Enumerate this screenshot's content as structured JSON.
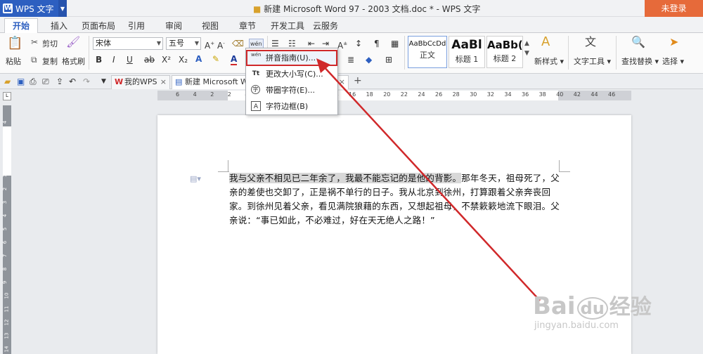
{
  "titlebar": {
    "app_button": "WPS 文字",
    "doc_title": "新建 Microsoft Word 97 - 2003 文档.doc * - WPS 文字",
    "login": "未登录"
  },
  "menu_tabs": [
    "开始",
    "插入",
    "页面布局",
    "引用",
    "审阅",
    "视图",
    "章节",
    "开发工具",
    "云服务"
  ],
  "ribbon": {
    "paste": "粘贴",
    "cut": "剪切",
    "copy": "复制",
    "format_painter": "格式刷",
    "font_name": "宋体",
    "font_size": "五号",
    "bold": "B",
    "italic": "I",
    "underline": "U",
    "styles": [
      {
        "preview": "AaBbCcDd",
        "name": "正文"
      },
      {
        "preview": "AaBl",
        "name": "标题 1"
      },
      {
        "preview": "AaBb(",
        "name": "标题 2"
      }
    ],
    "new_style": "新样式",
    "text_tools": "文字工具",
    "find_replace": "查找替换",
    "select": "选择"
  },
  "doc_tabs": [
    {
      "label": "我的WPS"
    },
    {
      "label": "新建 Microsoft W"
    }
  ],
  "dropdown": {
    "items": [
      {
        "icon": "wén",
        "label": "拼音指南(U)..."
      },
      {
        "icon": "Tt",
        "label": "更改大小写(C)..."
      },
      {
        "icon": "字",
        "label": "带圈字符(E)..."
      },
      {
        "icon": "A",
        "label": "字符边框(B)"
      }
    ]
  },
  "document": {
    "highlighted": "我与父亲不相见已二年余了，我最不能忘记的是他的背影。",
    "rest": "那年冬天，祖母死了，父亲的差使也交卸了，正是祸不单行的日子。我从北京到徐州，打算跟着父亲奔丧回家。到徐州见着父亲，看见满院狼藉的东西，又想起祖母，不禁簌簌地流下眼泪。父亲说：“事已如此，不必难过，好在天无绝人之路！”"
  },
  "hruler_labels": [
    "6",
    "4",
    "2",
    "2",
    "4",
    "6",
    "8",
    "10",
    "12",
    "14",
    "16",
    "18",
    "20",
    "22",
    "24",
    "26",
    "28",
    "30",
    "32",
    "34",
    "36",
    "38",
    "40",
    "42",
    "44",
    "46"
  ],
  "vruler_labels": [
    "4",
    "3",
    "2",
    "1",
    "1",
    "2",
    "3",
    "4",
    "5",
    "6",
    "7",
    "8",
    "9",
    "10",
    "11",
    "12",
    "13",
    "14"
  ],
  "watermark": {
    "brand": "Bai",
    "brand2": "经验",
    "url": "jingyan.baidu.com"
  },
  "colors": {
    "accent": "#2d5fc0",
    "login": "#e66a3a",
    "annotation": "#d0282a"
  }
}
